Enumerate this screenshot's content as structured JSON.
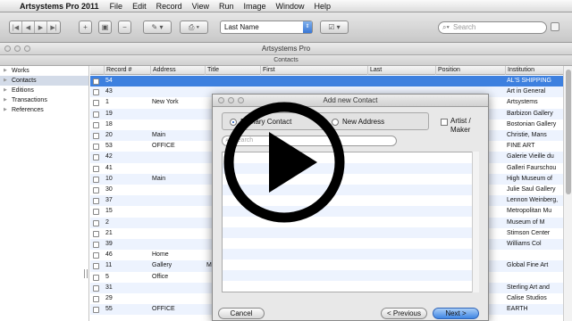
{
  "menu": {
    "app_name": "Artsystems Pro 2011",
    "items": [
      "File",
      "Edit",
      "Record",
      "View",
      "Run",
      "Image",
      "Window",
      "Help"
    ]
  },
  "toolbar": {
    "sort_field": "Last Name",
    "search_placeholder": "Search"
  },
  "window": {
    "title": "Artsystems Pro",
    "section": "Contacts"
  },
  "sidebar": {
    "items": [
      {
        "label": "Works",
        "selected": false
      },
      {
        "label": "Contacts",
        "selected": true
      },
      {
        "label": "Editions",
        "selected": false
      },
      {
        "label": "Transactions",
        "selected": false
      },
      {
        "label": "References",
        "selected": false
      }
    ]
  },
  "table": {
    "columns": [
      "Record #",
      "Address",
      "Title",
      "First",
      "Last",
      "Position",
      "Institution"
    ],
    "rows": [
      {
        "record": "54",
        "address": "",
        "title": "",
        "institution": "AL'S SHIPPING",
        "selected": true
      },
      {
        "record": "43",
        "address": "",
        "title": "",
        "institution": "Art in General"
      },
      {
        "record": "1",
        "address": "New York",
        "title": "",
        "institution": "Artsystems"
      },
      {
        "record": "19",
        "address": "",
        "title": "",
        "institution": "Barbizon Gallery"
      },
      {
        "record": "18",
        "address": "",
        "title": "",
        "institution": "Bostonian Gallery"
      },
      {
        "record": "20",
        "address": "Main",
        "title": "",
        "institution": "Christie, Mans"
      },
      {
        "record": "53",
        "address": "OFFICE",
        "title": "",
        "institution": "FINE ART"
      },
      {
        "record": "42",
        "address": "",
        "title": "",
        "institution": "Galerie Vieille du"
      },
      {
        "record": "41",
        "address": "",
        "title": "",
        "institution": "Galleri Faurschou"
      },
      {
        "record": "10",
        "address": "Main",
        "title": "",
        "institution": "High Museum of"
      },
      {
        "record": "30",
        "address": "",
        "title": "",
        "institution": "Julie Saul Gallery"
      },
      {
        "record": "37",
        "address": "",
        "title": "",
        "institution": "Lennon Weinberg,"
      },
      {
        "record": "15",
        "address": "",
        "title": "",
        "institution": "Metropolitan Mu"
      },
      {
        "record": "2",
        "address": "",
        "title": "",
        "institution": "Museum of M"
      },
      {
        "record": "21",
        "address": "",
        "title": "",
        "institution": "Stimson Center"
      },
      {
        "record": "39",
        "address": "",
        "title": "",
        "institution": "Williams Col"
      },
      {
        "record": "46",
        "address": "Home",
        "title": "",
        "institution": ""
      },
      {
        "record": "11",
        "address": "Gallery",
        "title": "M",
        "institution": "Global Fine Art"
      },
      {
        "record": "5",
        "address": "Office",
        "title": "",
        "institution": ""
      },
      {
        "record": "31",
        "address": "",
        "title": "",
        "institution": "Sterling Art and"
      },
      {
        "record": "29",
        "address": "",
        "title": "",
        "institution": "Calise Studios"
      },
      {
        "record": "55",
        "address": "OFFICE",
        "title": "",
        "institution": "EARTH"
      }
    ]
  },
  "dialog": {
    "title": "Add new Contact",
    "radio_primary": "Primary Contact",
    "radio_new_address": "New Address",
    "artist_label": "Artist / Maker",
    "search_placeholder": "Search",
    "cancel_label": "Cancel",
    "previous_label": "< Previous",
    "next_label": "Next >"
  },
  "colors": {
    "selection": "#3d80df",
    "alt_row": "#edf3fe",
    "play_overlay": "#000000"
  }
}
